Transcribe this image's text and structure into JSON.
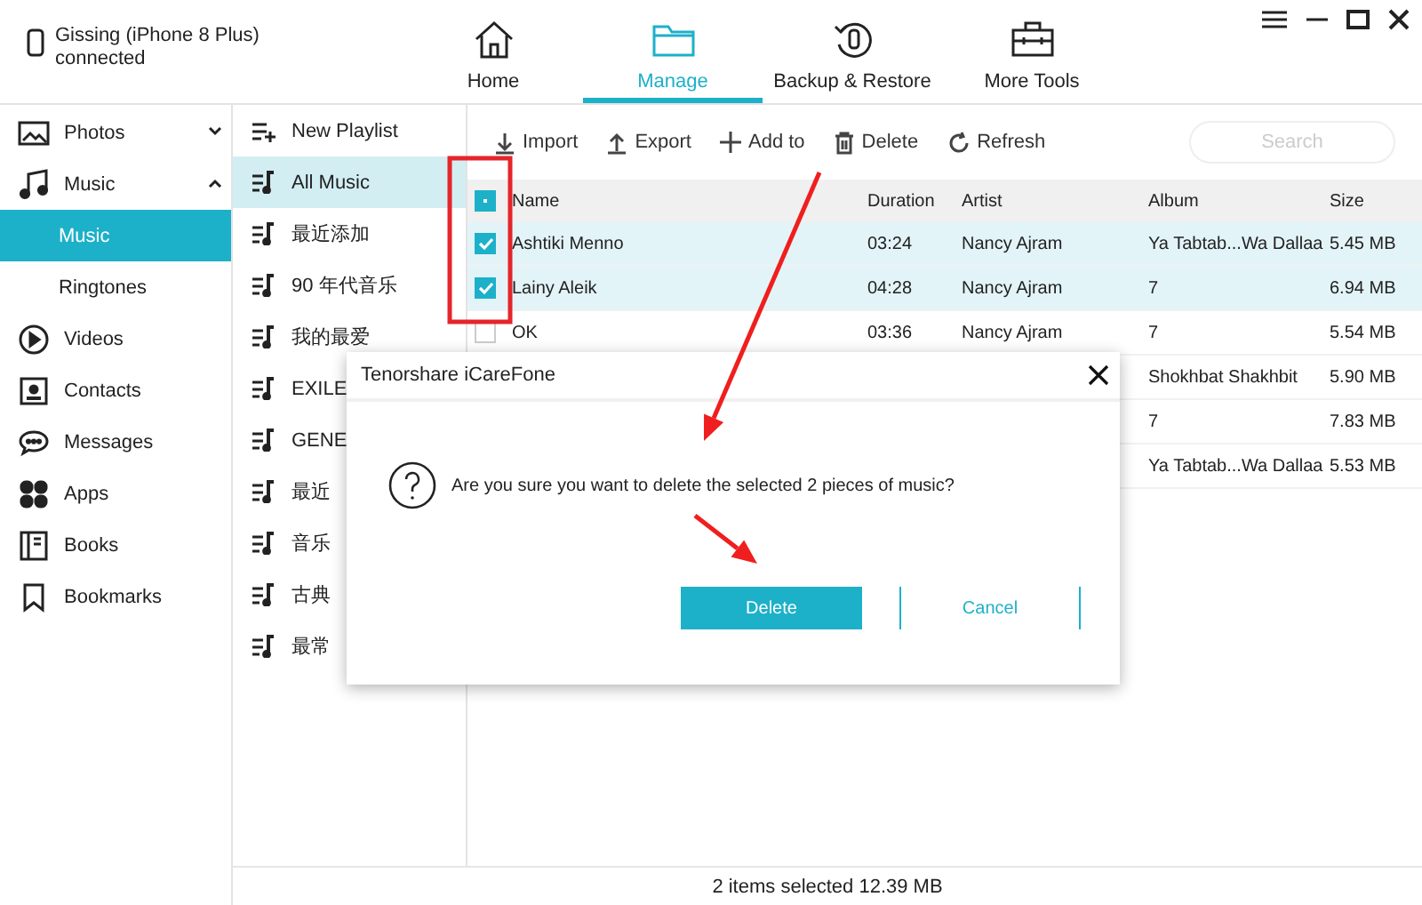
{
  "device": {
    "name": "Gissing (iPhone 8 Plus)",
    "status": "connected"
  },
  "nav_tabs": [
    {
      "label": "Home",
      "selected": false
    },
    {
      "label": "Manage",
      "selected": true
    },
    {
      "label": "Backup & Restore",
      "selected": false
    },
    {
      "label": "More Tools",
      "selected": false
    }
  ],
  "sidebar": {
    "items": [
      {
        "label": "Photos",
        "expanded": false,
        "selected": false
      },
      {
        "label": "Music",
        "expanded": true,
        "selected": false,
        "children": [
          {
            "label": "Music",
            "selected": true
          },
          {
            "label": "Ringtones",
            "selected": false
          }
        ]
      },
      {
        "label": "Videos",
        "selected": false
      },
      {
        "label": "Contacts",
        "selected": false
      },
      {
        "label": "Messages",
        "selected": false
      },
      {
        "label": "Apps",
        "selected": false
      },
      {
        "label": "Books",
        "selected": false
      },
      {
        "label": "Bookmarks",
        "selected": false
      }
    ]
  },
  "playlists": [
    {
      "kind": "new",
      "label": "New Playlist",
      "selected": false
    },
    {
      "kind": "playlist",
      "label": "All Music",
      "selected": true
    },
    {
      "kind": "playlist",
      "label": "最近添加",
      "selected": false
    },
    {
      "kind": "playlist",
      "label": "90 年代音乐",
      "selected": false
    },
    {
      "kind": "playlist",
      "label": "我的最爱",
      "selected": false
    },
    {
      "kind": "playlist",
      "label": "EXILE",
      "selected": false
    },
    {
      "kind": "playlist",
      "label": "GENE",
      "selected": false
    },
    {
      "kind": "playlist",
      "label": "最近",
      "selected": false
    },
    {
      "kind": "playlist",
      "label": "音乐",
      "selected": false
    },
    {
      "kind": "playlist",
      "label": "古典",
      "selected": false
    },
    {
      "kind": "playlist",
      "label": "最常",
      "selected": false
    }
  ],
  "toolbar": {
    "buttons": [
      "Import",
      "Export",
      "Add to",
      "Delete",
      "Refresh"
    ],
    "search": {
      "placeholder": "Search"
    }
  },
  "table": {
    "select_all": {
      "indeterminate": true
    },
    "columns": [
      "Name",
      "Duration",
      "Artist",
      "Album",
      "Size"
    ],
    "rows": [
      {
        "checked": true,
        "selected": true,
        "name": "Ashtiki Menno",
        "duration": "03:24",
        "artist": "Nancy Ajram",
        "album": "Ya Tabtab...Wa Dallaa",
        "size": "5.45 MB"
      },
      {
        "checked": true,
        "selected": true,
        "name": "Lainy Aleik",
        "duration": "04:28",
        "artist": "Nancy Ajram",
        "album": "7",
        "size": "6.94 MB"
      },
      {
        "checked": false,
        "selected": false,
        "name": "OK",
        "duration": "03:36",
        "artist": "Nancy Ajram",
        "album": "7",
        "size": "5.54 MB"
      },
      {
        "selected": false,
        "album": "Shokhbat Shakhbit",
        "size": "5.90 MB"
      },
      {
        "selected": false,
        "album": "7",
        "size": "7.83 MB"
      },
      {
        "selected": false,
        "album": "Ya Tabtab...Wa Dallaa",
        "size": "5.53 MB"
      }
    ]
  },
  "dialog": {
    "title": "Tenorshare iCareFone",
    "message": "Are you sure you want to delete the selected 2 pieces of music?",
    "buttons": [
      {
        "label": "Delete",
        "kind": "primary"
      },
      {
        "label": "Cancel",
        "kind": "secondary"
      }
    ]
  },
  "status_bar": "2 items selected 12.39 MB",
  "annotations": [
    {
      "kind": "highlight-box"
    },
    {
      "kind": "arrow"
    },
    {
      "kind": "arrow"
    }
  ]
}
